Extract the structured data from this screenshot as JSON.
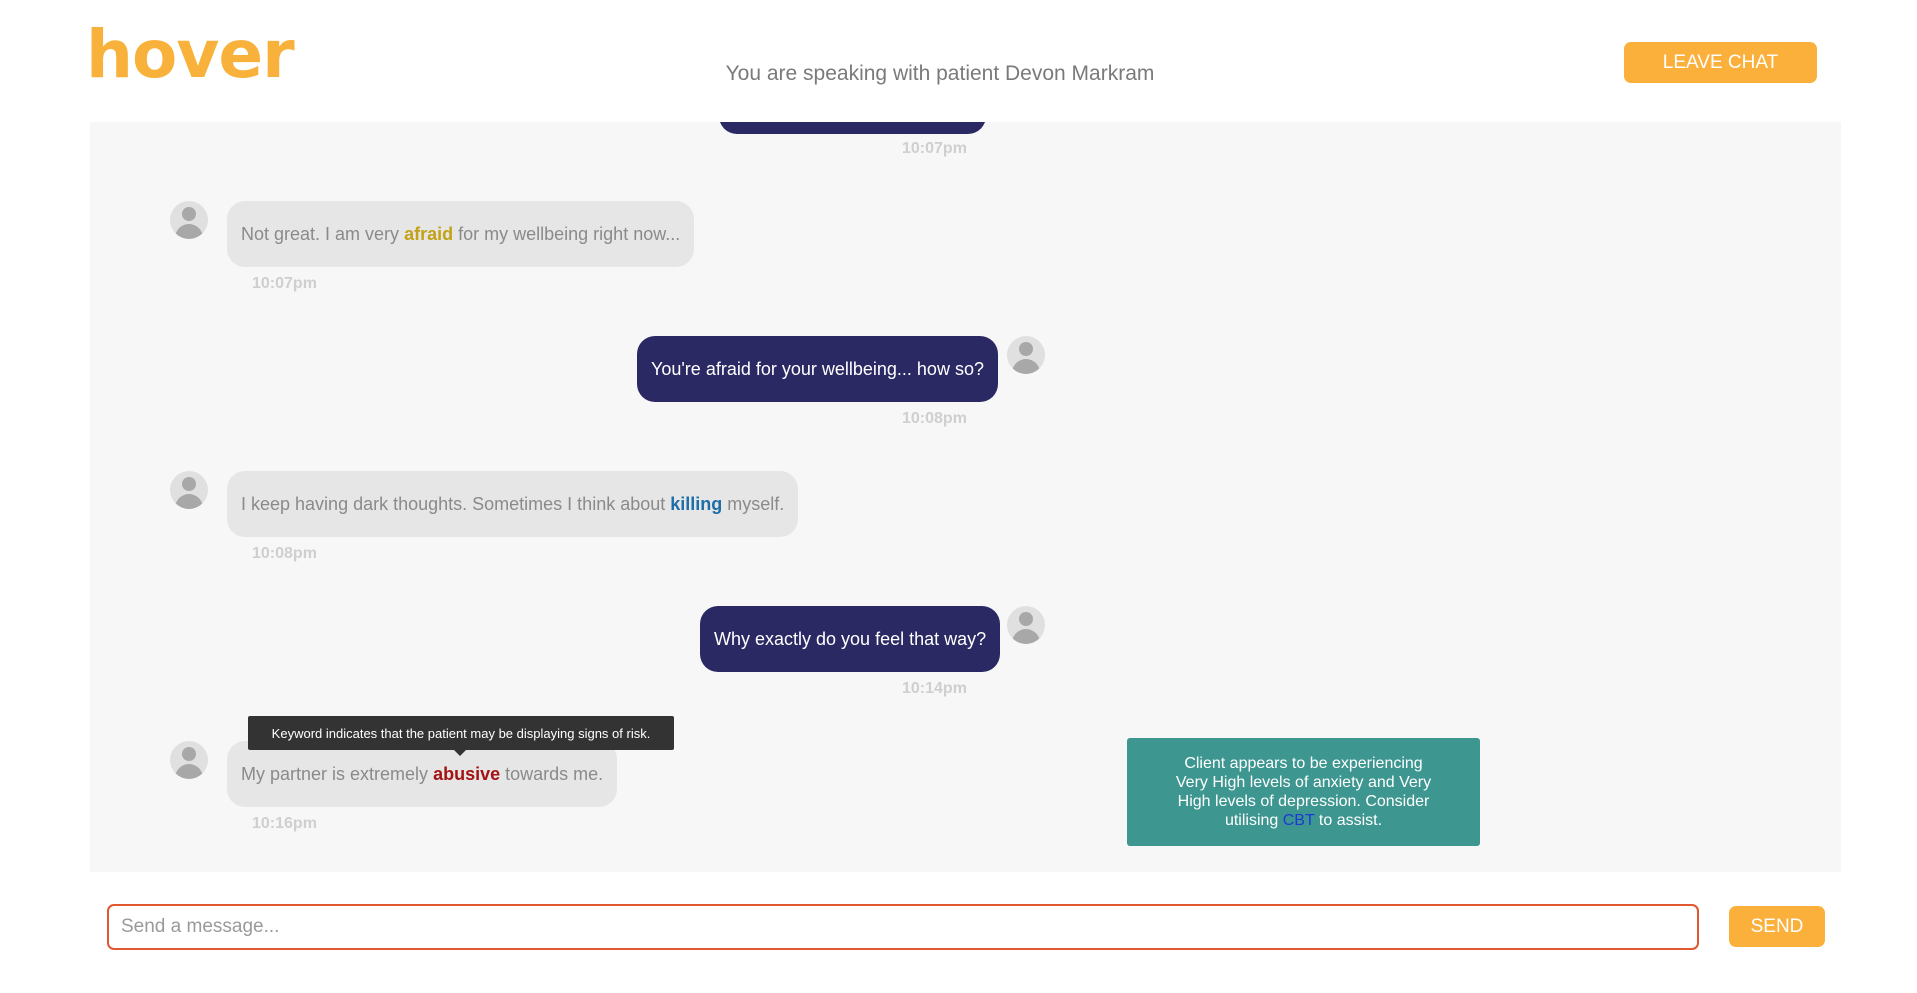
{
  "app": {
    "logo": "hover"
  },
  "header": {
    "title": "You are speaking with patient Devon Markram",
    "leave_label": "LEAVE CHAT"
  },
  "messages": [
    {
      "from": "counsellor",
      "text": "",
      "time": "10:07pm"
    },
    {
      "from": "patient",
      "pre": "Not great. I am very ",
      "keyword": "afraid",
      "post": " for my wellbeing right now...",
      "time": "10:07pm"
    },
    {
      "from": "counsellor",
      "text": "You're afraid for your wellbeing... how so?",
      "time": "10:08pm"
    },
    {
      "from": "patient",
      "pre": "I keep having dark thoughts. Sometimes I think about ",
      "keyword": "killing",
      "post": " myself.",
      "time": "10:08pm"
    },
    {
      "from": "counsellor",
      "text": "Why exactly do you feel that way?",
      "time": "10:14pm"
    },
    {
      "from": "patient",
      "pre": "My partner is extremely ",
      "keyword": "abusive",
      "post": " towards me.",
      "time": "10:16pm"
    }
  ],
  "tooltip": {
    "text": "Keyword indicates that the patient may be displaying signs of risk."
  },
  "suggestion": {
    "pre": "Client appears to be experiencing Very High levels of anxiety and Very High levels of depression. Consider utilising ",
    "link": "CBT",
    "post": " to assist."
  },
  "composer": {
    "placeholder": "Send a message...",
    "send_label": "SEND"
  },
  "colors": {
    "brand_orange": "#fbb03b",
    "counsellor_bubble": "#2b2963",
    "patient_bubble": "#e6e6e6",
    "suggestion_bg": "#3d9690",
    "keyword_afraid": "#c4a216",
    "keyword_killing": "#1e6ea8",
    "keyword_abusive": "#a31313"
  }
}
